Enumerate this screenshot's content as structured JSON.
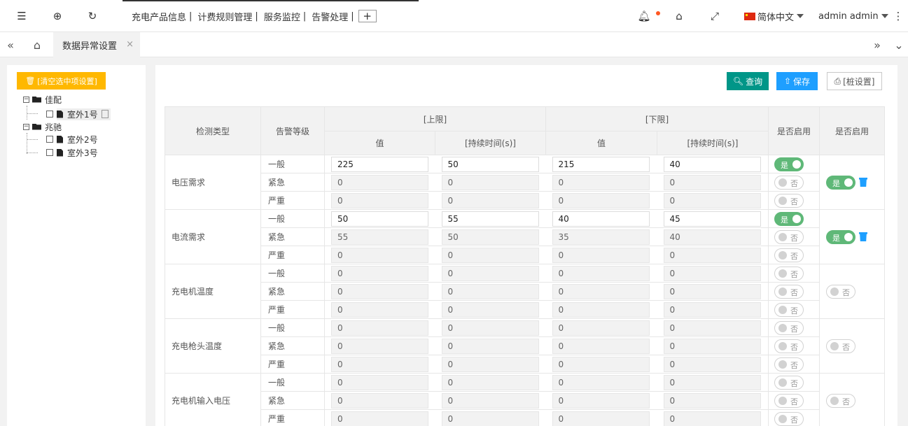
{
  "header": {
    "menu": [
      "充电产品信息",
      "计费规则管理",
      "服务监控",
      "告警处理"
    ],
    "separator": "|",
    "add_label": "+",
    "language": "简体中文",
    "user": "admin admin",
    "icons": [
      "menu-toggle-icon",
      "globe-icon",
      "refresh-icon",
      "bell-icon",
      "tag-icon",
      "fullscreen-icon",
      "more-icon"
    ]
  },
  "tabs": {
    "active": "数据异常设置",
    "close": "×"
  },
  "tree": {
    "clear_button": "[清空选中项设置]",
    "groups": [
      {
        "name": "佳配",
        "children": [
          "室外1号"
        ]
      },
      {
        "name": "兆驰",
        "children": [
          "室外2号",
          "室外3号"
        ]
      }
    ]
  },
  "toolbar": {
    "query": "查询",
    "save": "保存",
    "pile_setting": "[桩设置]"
  },
  "table": {
    "headers": {
      "type": "检测类型",
      "level": "告警等级",
      "upper": "[上限]",
      "lower": "[下限]",
      "value": "值",
      "duration": "[持续时间(s)]",
      "enabled_level": "是否启用",
      "enabled_group": "是否启用"
    },
    "toggle_on": "是",
    "toggle_off": "否",
    "rows": [
      {
        "type": "电压需求",
        "enabled": true,
        "levels": [
          {
            "level": "一般",
            "values": [
              "225",
              "50",
              "215",
              "40"
            ],
            "on": true
          },
          {
            "level": "紧急",
            "values": [
              "0",
              "0",
              "0",
              "0"
            ],
            "on": false
          },
          {
            "level": "严重",
            "values": [
              "0",
              "0",
              "0",
              "0"
            ],
            "on": false
          }
        ]
      },
      {
        "type": "电流需求",
        "enabled": true,
        "levels": [
          {
            "level": "一般",
            "values": [
              "50",
              "55",
              "40",
              "45"
            ],
            "on": true
          },
          {
            "level": "紧急",
            "values": [
              "55",
              "50",
              "35",
              "40"
            ],
            "on": false
          },
          {
            "level": "严重",
            "values": [
              "0",
              "0",
              "0",
              "0"
            ],
            "on": false
          }
        ]
      },
      {
        "type": "充电机温度",
        "enabled": false,
        "levels": [
          {
            "level": "一般",
            "values": [
              "0",
              "0",
              "0",
              "0"
            ],
            "on": false
          },
          {
            "level": "紧急",
            "values": [
              "0",
              "0",
              "0",
              "0"
            ],
            "on": false
          },
          {
            "level": "严重",
            "values": [
              "0",
              "0",
              "0",
              "0"
            ],
            "on": false
          }
        ]
      },
      {
        "type": "充电枪头温度",
        "enabled": false,
        "levels": [
          {
            "level": "一般",
            "values": [
              "0",
              "0",
              "0",
              "0"
            ],
            "on": false
          },
          {
            "level": "紧急",
            "values": [
              "0",
              "0",
              "0",
              "0"
            ],
            "on": false
          },
          {
            "level": "严重",
            "values": [
              "0",
              "0",
              "0",
              "0"
            ],
            "on": false
          }
        ]
      },
      {
        "type": "充电机输入电压",
        "enabled": false,
        "levels": [
          {
            "level": "一般",
            "values": [
              "0",
              "0",
              "0",
              "0"
            ],
            "on": false
          },
          {
            "level": "紧急",
            "values": [
              "0",
              "0",
              "0",
              "0"
            ],
            "on": false
          },
          {
            "level": "严重",
            "values": [
              "0",
              "0",
              "0",
              "0"
            ],
            "on": false
          }
        ]
      }
    ]
  }
}
